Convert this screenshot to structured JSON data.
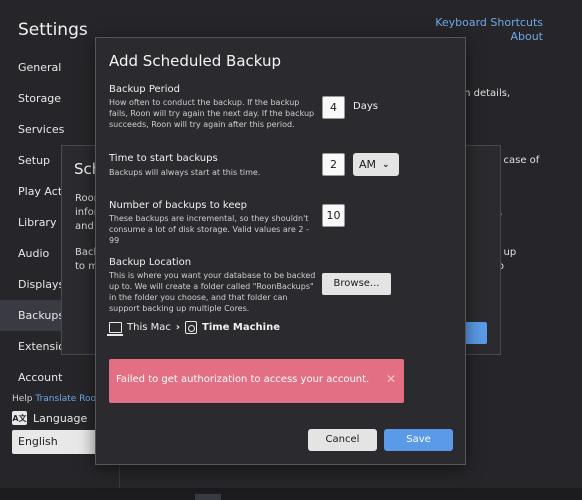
{
  "settings": {
    "title": "Settings",
    "keyboard_shortcuts": "Keyboard Shortcuts",
    "about": "About",
    "sidebar": [
      {
        "label": "General"
      },
      {
        "label": "Storage"
      },
      {
        "label": "Services"
      },
      {
        "label": "Setup"
      },
      {
        "label": "Play Actions"
      },
      {
        "label": "Library"
      },
      {
        "label": "Audio"
      },
      {
        "label": "Displays"
      },
      {
        "label": "Backups"
      },
      {
        "label": "Extensions"
      },
      {
        "label": "Account"
      }
    ],
    "help_prefix": "Help",
    "help_link": "Translate Roon!",
    "language_label": "Language",
    "language_icon": "A文",
    "language_value": "English",
    "bg_right": [
      "on details,",
      "n case of",
      "s,",
      "g up"
    ],
    "bg_right_extra": "to"
  },
  "middle_modal": {
    "title": "Sche",
    "line1": "Roon",
    "line2": "inform",
    "line3": "and",
    "line4": "Back",
    "line5": "to m"
  },
  "dialog": {
    "title": "Add Scheduled Backup",
    "period": {
      "label": "Backup Period",
      "desc": "How often to conduct the backup. If the backup fails, Roon will try again the next day. If the backup succeeds, Roon will try again after this period.",
      "value": "4",
      "unit": "Days"
    },
    "start_time": {
      "label": "Time to start backups",
      "desc": "Backups will always start at this time.",
      "value": "2",
      "ampm": "AM"
    },
    "keep": {
      "label": "Number of backups to keep",
      "desc": "These backups are incremental, so they shouldn't consume a lot of disk storage. Valid values are 2 - 99",
      "value": "10"
    },
    "location": {
      "label": "Backup Location",
      "desc": "This is where you want your database to be backed up to. We will create a folder called \"RoonBackups\" in the folder you choose, and that folder can support backing up multiple Cores.",
      "browse": "Browse...",
      "path_root": "This Mac",
      "path_leaf": "Time Machine"
    },
    "error": "Failed to get authorization to access your account.",
    "error_close": "✕",
    "cancel": "Cancel",
    "save": "Save"
  },
  "colors": {
    "accent": "#5b9ae6",
    "error": "#e36f84",
    "link": "#6ea8e6"
  }
}
